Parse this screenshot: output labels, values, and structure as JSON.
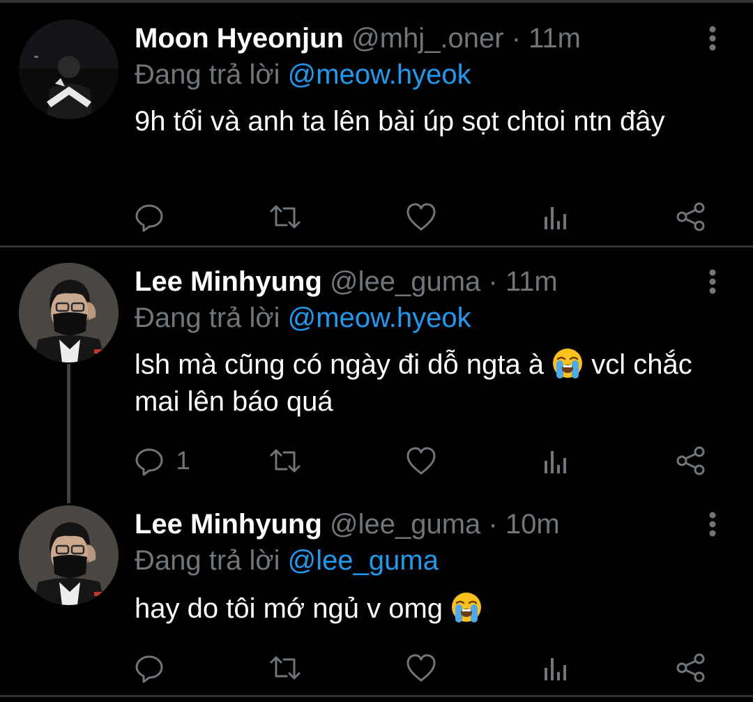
{
  "tweets": [
    {
      "display_name": "Moon Hyeonjun",
      "handle": "@mhj_.oner",
      "separator": "·",
      "time": "11m",
      "replying_prefix": "Đang trả lời",
      "replying_to": "@meow.hyeok",
      "text": "9h tối và anh ta lên bài úp sọt chtoi ntn đây",
      "reply_count": "",
      "avatar_icon": "user-avatar-photo"
    },
    {
      "display_name": "Lee Minhyung",
      "handle": "@lee_guma",
      "separator": "·",
      "time": "11m",
      "replying_prefix": "Đang trả lời",
      "replying_to": "@meow.hyeok",
      "text_before_emoji": "lsh mà cũng có ngày đi dỗ ngta à ",
      "emoji": "loudly-crying-face",
      "text_after_emoji": " vcl chắc mai lên báo quá",
      "reply_count": "1",
      "avatar_icon": "user-avatar-photo"
    },
    {
      "display_name": "Lee Minhyung",
      "handle": "@lee_guma",
      "separator": "·",
      "time": "10m",
      "replying_prefix": "Đang trả lời",
      "replying_to": "@lee_guma",
      "text_before_emoji": "hay do tôi mớ ngủ v omg ",
      "emoji": "loudly-crying-face",
      "reply_count": "",
      "avatar_icon": "user-avatar-photo"
    }
  ],
  "action_icons": [
    "reply-icon",
    "retweet-icon",
    "like-icon",
    "analytics-icon",
    "share-icon"
  ],
  "colors": {
    "background": "#000000",
    "text_primary": "#ffffff",
    "text_secondary": "#71767b",
    "accent": "#1d9bf0",
    "divider": "#2f3336"
  }
}
